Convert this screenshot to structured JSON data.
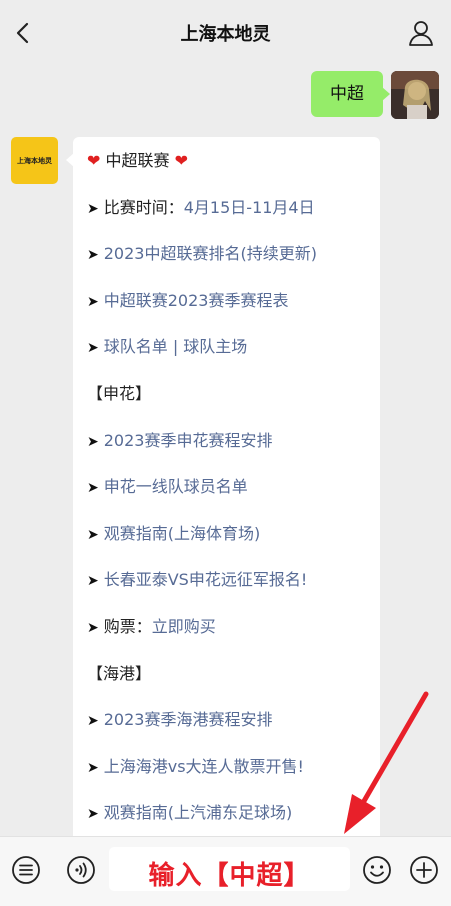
{
  "header": {
    "title": "上海本地灵",
    "back_icon": "chevron-left-icon",
    "profile_icon": "user-icon"
  },
  "user_message": {
    "text": "中超"
  },
  "bot": {
    "avatar_label": "上海本地灵",
    "heading": "中超联赛",
    "heart": "❤",
    "arrow": "➤",
    "schedule_label": "比赛时间：",
    "schedule_value": "4月15日-11月4日",
    "links_a": [
      "2023中超联赛排名(持续更新)",
      "中超联赛2023赛季赛程表",
      "球队名单 | 球队主场"
    ],
    "section_shenhua": "【申花】",
    "links_b": [
      "2023赛季申花赛程安排",
      "申花一线队球员名单",
      "观赛指南(上海体育场)",
      "长春亚泰VS申花远征军报名!"
    ],
    "ticket_label": "购票：",
    "ticket_link": "立即购买",
    "section_haigang": "【海港】",
    "links_c": [
      "2023赛季海港赛程安排",
      "上海海港vs大连人散票开售!",
      "观赛指南(上汽浦东足球场)"
    ]
  },
  "input_bar": {
    "text": "输入【中超】",
    "voice_icon": "voice-icon",
    "menu_icon": "menu-list-icon",
    "emoji_icon": "emoji-icon",
    "plus_icon": "plus-icon"
  },
  "colors": {
    "link": "#576b95",
    "bubble_green": "#95ec69",
    "highlight_red": "#e8202a"
  }
}
